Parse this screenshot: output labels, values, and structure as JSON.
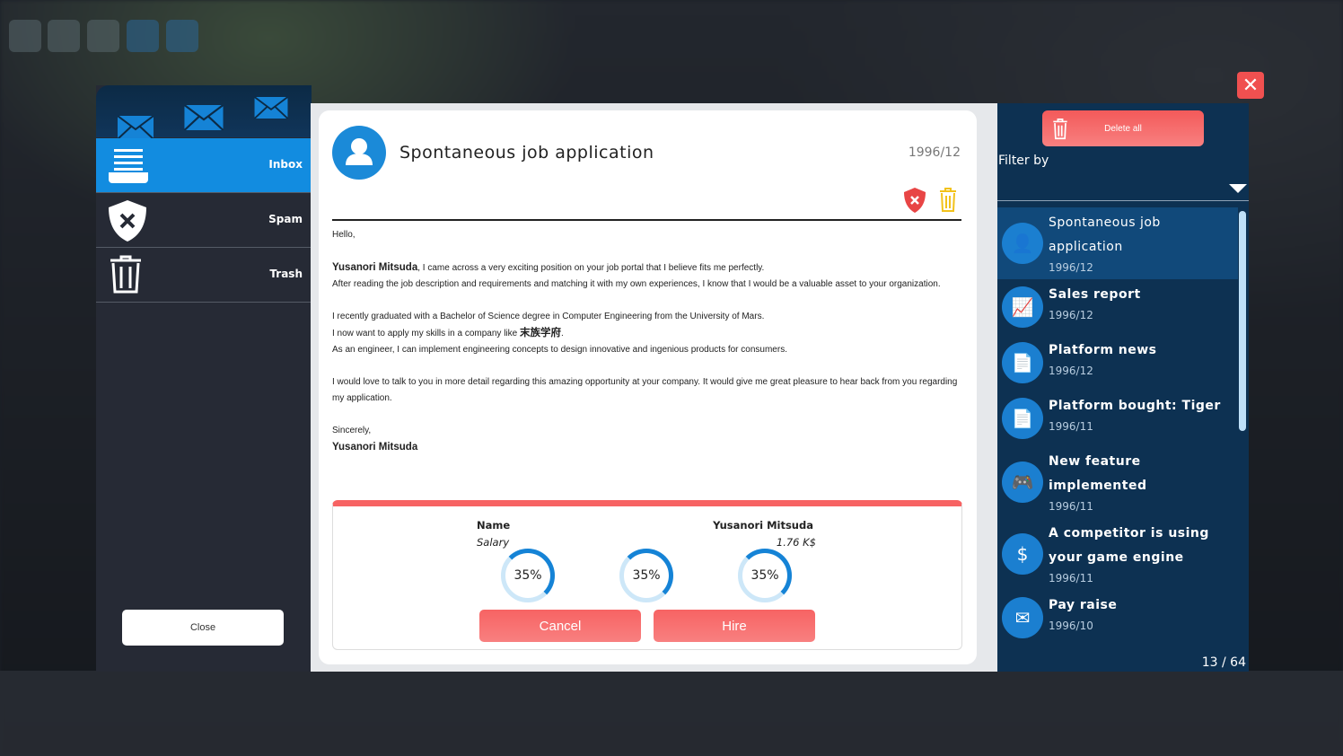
{
  "sidebar": {
    "items": [
      {
        "label": "Inbox",
        "icon": "inbox-icon"
      },
      {
        "label": "Spam",
        "icon": "spam-shield-icon"
      },
      {
        "label": "Trash",
        "icon": "trash-icon"
      }
    ],
    "close": "Close"
  },
  "message": {
    "title": "Spontaneous job application",
    "date": "1996/12",
    "greeting": "Hello,",
    "sender": "Yusanori Mitsuda",
    "p1a": ", I came across a very exciting position on your job portal that I believe fits me perfectly.",
    "p1b": "After reading the job description and requirements and matching it with my own experiences, I know that I would be a valuable asset to your organization.",
    "p2a": "I recently graduated with a Bachelor of Science degree in Computer Engineering from the University of Mars.",
    "p2b": "I now want to apply my skills in a company like ",
    "company": "末族学府",
    "p2c": "As an engineer, I can implement engineering concepts to design innovative and ingenious products for consumers.",
    "p3": "I would love to talk to you in more detail regarding this amazing opportunity at your company. It would give me great pleasure to hear back from you regarding my application.",
    "closing": "Sincerely,",
    "signature": "Yusanori Mitsuda"
  },
  "offer": {
    "name_label": "Name",
    "name_value": "Yusanori Mitsuda",
    "salary_label": "Salary",
    "salary_value": "1.76 K$",
    "skills": [
      {
        "label": "35%",
        "value": 35
      },
      {
        "label": "35%",
        "value": 35
      },
      {
        "label": "35%",
        "value": 35
      }
    ],
    "cancel": "Cancel",
    "hire": "Hire"
  },
  "right": {
    "delete_all": "Delete all",
    "filter_label": "Filter by",
    "count": "13 / 64",
    "messages": [
      {
        "title": "Spontaneous job application",
        "date": "1996/12",
        "icon": "person-icon",
        "active": true
      },
      {
        "title": "Sales report",
        "date": "1996/12",
        "icon": "chart-up-icon"
      },
      {
        "title": "Platform news",
        "date": "1996/12",
        "icon": "document-icon"
      },
      {
        "title": "Platform bought: Tiger",
        "date": "1996/11",
        "icon": "document-icon"
      },
      {
        "title": "New feature implemented",
        "date": "1996/11",
        "icon": "gamepad-gear-icon"
      },
      {
        "title": "A competitor is using your game engine",
        "date": "1996/11",
        "icon": "money-hand-icon"
      },
      {
        "title": "Pay raise",
        "date": "1996/10",
        "icon": "money-envelope-icon"
      }
    ]
  },
  "colors": {
    "accent": "#128ce0",
    "danger": "#f76363",
    "panel": "#0d3152"
  }
}
